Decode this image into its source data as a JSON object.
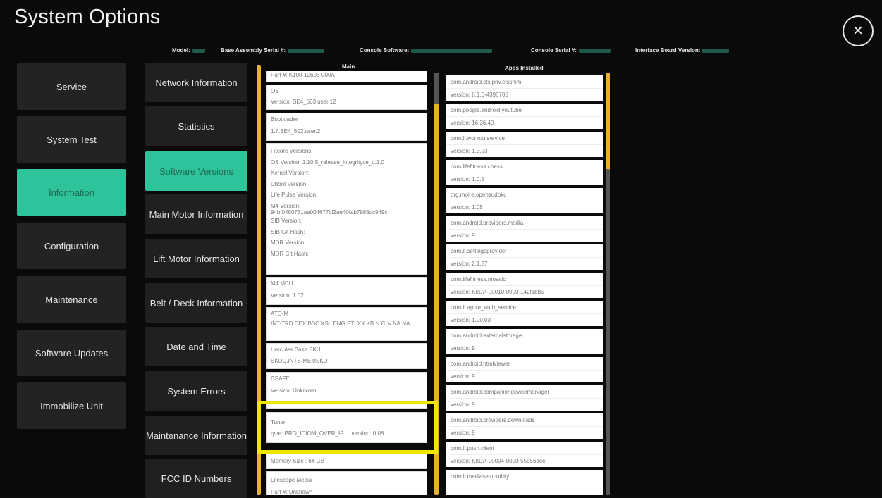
{
  "window": {
    "title": "System Options"
  },
  "close_icon": "×",
  "info_bar": [
    {
      "label": "Model:"
    },
    {
      "label": "Base Assembly Serial #:"
    },
    {
      "label": "Console Software:"
    },
    {
      "label": "Console Serial #:"
    },
    {
      "label": "Interface Board Version:"
    }
  ],
  "left_menu": [
    {
      "label": "Service"
    },
    {
      "label": "System Test"
    },
    {
      "label": "Information"
    },
    {
      "label": "Configuration"
    },
    {
      "label": "Maintenance"
    },
    {
      "label": "Software Updates"
    },
    {
      "label": "Immobilize Unit"
    }
  ],
  "sub_menu": [
    {
      "label": "Network Information"
    },
    {
      "label": "Statistics"
    },
    {
      "label": "Software Versions"
    },
    {
      "label": "Main Motor Information"
    },
    {
      "label": "Lift Motor Information"
    },
    {
      "label": "Belt / Deck Information"
    },
    {
      "label": "Date and Time"
    },
    {
      "label": "System Errors"
    },
    {
      "label": "Maintenance Information"
    },
    {
      "label": "FCC ID Numbers"
    }
  ],
  "main": {
    "header": "Main",
    "cards": [
      {
        "lines": [
          "Part #: K100-12603-000A"
        ]
      },
      {
        "lines": [
          "OS",
          "Version: SE4_503 user.12"
        ]
      },
      {
        "lines": [
          "Bootloader",
          "1.7.SE4_502.user.2"
        ]
      },
      {
        "lines": [
          "Fitcore Versions",
          "OS Version: 1.10.5_release_integrityce_d.1.0",
          "Kernel Version:",
          "Uboot Version:",
          "Life Pulse Version:",
          "M4 Version:",
          "94bf0480731ae004677cf2ae40fab7985dc949c",
          "SIB Version:",
          "SIB Git Hash:",
          "MDR Version:",
          "MDR Git Hash:"
        ]
      },
      {
        "lines": [
          "M4 MCU",
          "Version: 1.02"
        ]
      },
      {
        "lines": [
          "ATO-M",
          "INT-TRD.DEX.BSC.XSL.ENG.STLXX.KB.N.CLV.NA.NA"
        ]
      },
      {
        "lines": [
          "Hercules Base SKU",
          "SKUC.INTS-MEMSKU"
        ]
      },
      {
        "lines": [
          "CSAFE",
          "Version: Unknown"
        ]
      },
      {
        "lines": [
          "Tuner",
          "type: PRO_IDIOM_OVER_IP     version: 0.08"
        ]
      },
      {
        "lines": [
          "Memory Size : 64 GB"
        ]
      },
      {
        "lines": [
          "Lifescape Media",
          "Part #: Unknown"
        ]
      }
    ]
  },
  "apps": {
    "header": "Apps Installed",
    "items": [
      {
        "name": "com.android.cts.priv.ctsshim",
        "version": "version: 8.1.0-4396705"
      },
      {
        "name": "com.google.android.youtube",
        "version": "version: 16.36.40"
      },
      {
        "name": "com.lf.workoutservice",
        "version": "version: 1.3.23"
      },
      {
        "name": "com.lifefitness.chess",
        "version": "version: 1.0.5"
      },
      {
        "name": "org.moire.opensudoku",
        "version": "version: 1.05"
      },
      {
        "name": "com.android.providers.media",
        "version": "version: 9"
      },
      {
        "name": "com.lf.settingsprovider",
        "version": "version: 2.1.37"
      },
      {
        "name": "com.lifefitness.mosaic",
        "version": "version: KIIDA-00010-0000-142f1bb5"
      },
      {
        "name": "com.lf.apple_auth_service",
        "version": "version: 1.00.03"
      },
      {
        "name": "com.android.externalstorage",
        "version": "version: 9"
      },
      {
        "name": "com.android.htmlviewer",
        "version": "version: 9"
      },
      {
        "name": "com.android.companiondevicemanager",
        "version": "version: 9"
      },
      {
        "name": "com.android.providers.downloads",
        "version": "version: 9"
      },
      {
        "name": "com.lf.push.client",
        "version": "version: KIIDA-00004-0000-55a56aee"
      },
      {
        "name": "com.lf.mediasetuputility",
        "version": ""
      }
    ]
  },
  "colors": {
    "accent": "#2ec39b",
    "scrollbar": "#e8b12a",
    "highlight": "#f1e400"
  }
}
